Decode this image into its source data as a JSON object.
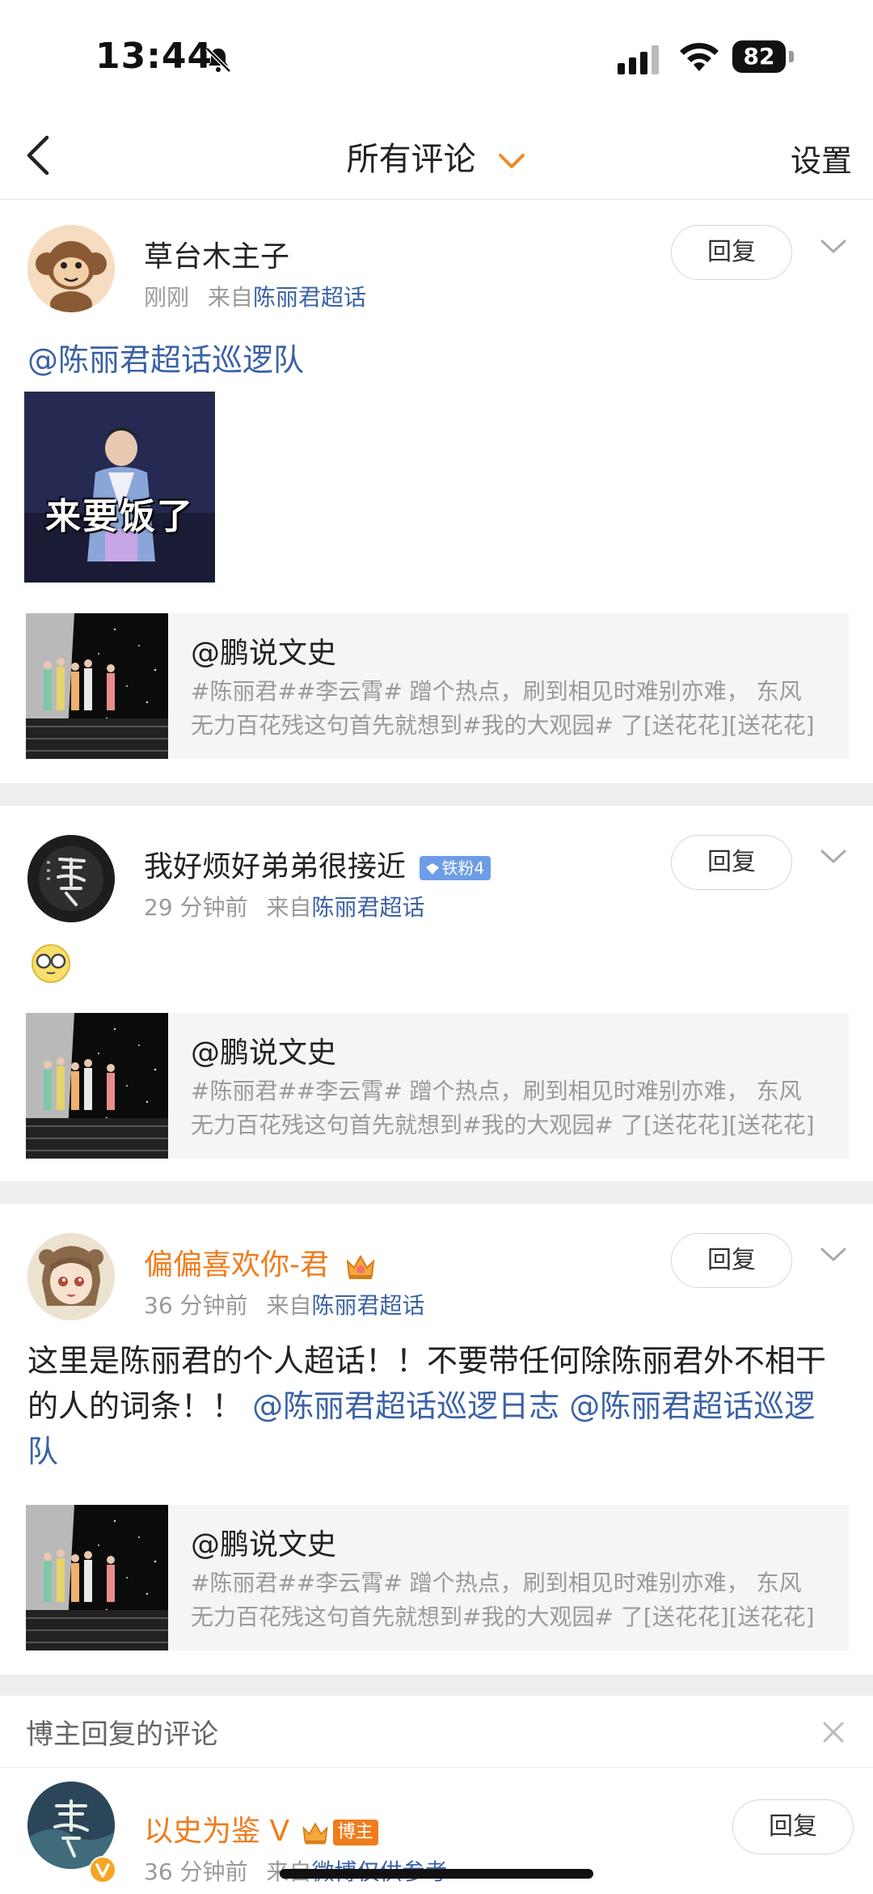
{
  "status_bar": {
    "time": "13:44",
    "battery": "82"
  },
  "header": {
    "title": "所有评论",
    "settings": "设置"
  },
  "comments": [
    {
      "username": "草台木主子",
      "time": "刚刚",
      "from_prefix": "来自",
      "from_link": "陈丽君超话",
      "reply_label": "回复",
      "mention": "@陈丽君超话巡逻队",
      "image_caption": "来要饭了",
      "quote": {
        "name": "@鹏说文史",
        "line1": "#陈丽君##李云霄# 蹭个热点，刷到相见时难别亦难， 东风",
        "line2": "无力百花残这句首先就想到#我的大观园# 了[送花花][送花花]"
      }
    },
    {
      "username": "我好烦好弟弟很接近",
      "badge": "铁粉4",
      "time": "29 分钟前",
      "from_prefix": "来自",
      "from_link": "陈丽君超话",
      "reply_label": "回复",
      "quote": {
        "name": "@鹏说文史",
        "line1": "#陈丽君##李云霄# 蹭个热点，刷到相见时难别亦难， 东风",
        "line2": "无力百花残这句首先就想到#我的大观园# 了[送花花][送花花]"
      }
    },
    {
      "username": "偏偏喜欢你-君",
      "time": "36 分钟前",
      "from_prefix": "来自",
      "from_link": "陈丽君超话",
      "reply_label": "回复",
      "text_plain": "这里是陈丽君的个人超话！！不要带任何除陈丽君外不相干的人的词条！！",
      "text_link1": "@陈丽君超话巡逻日志",
      "text_link2": "@陈丽君超话巡逻队",
      "quote": {
        "name": "@鹏说文史",
        "line1": "#陈丽君##李云霄# 蹭个热点，刷到相见时难别亦难， 东风",
        "line2": "无力百花残这句首先就想到#我的大观园# 了[送花花][送花花]"
      }
    }
  ],
  "owner_section": {
    "label": "博主回复的评论",
    "username": "以史为鉴",
    "v_mark": "V",
    "host_tag": "博主",
    "time": "36 分钟前",
    "from_prefix": "来自",
    "from_text": "微博仅供参考",
    "reply_label": "回复"
  }
}
